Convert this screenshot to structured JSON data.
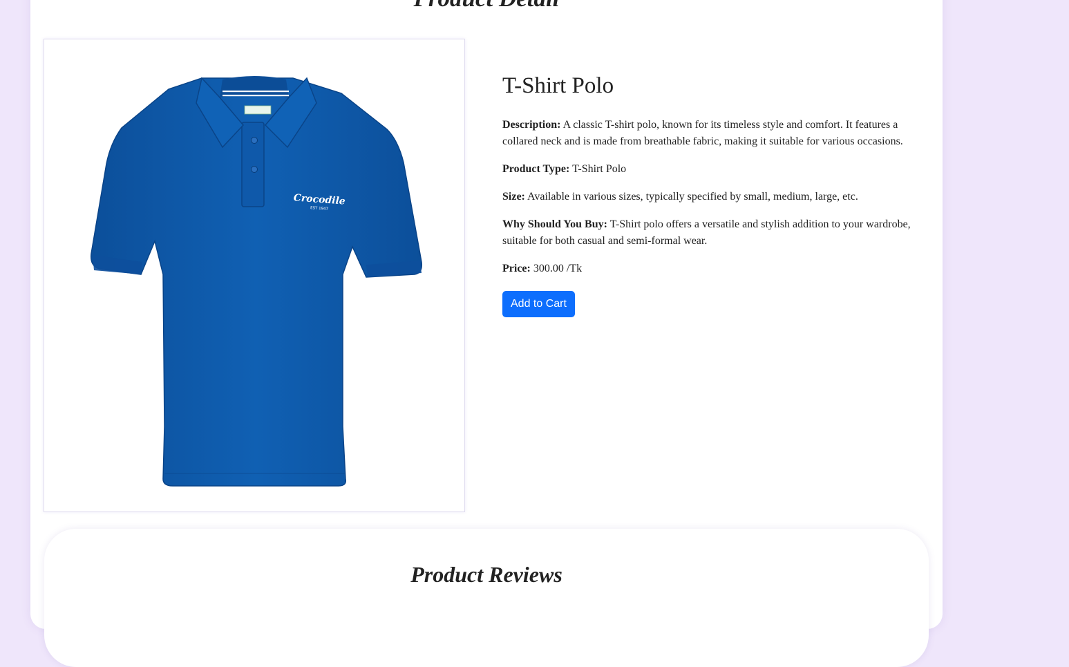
{
  "page": {
    "title": "Product Detail"
  },
  "product": {
    "name": "T-Shirt Polo",
    "image_alt": "Blue Crocodile polo t-shirt",
    "image_logo_text": "Crocodile",
    "image_logo_subtext": "EST 1947",
    "fields": [
      {
        "label": "Description:",
        "value": "A classic T-shirt polo, known for its timeless style and comfort. It features a collared neck and is made from breathable fabric, making it suitable for various occasions."
      },
      {
        "label": "Product Type:",
        "value": "T-Shirt Polo"
      },
      {
        "label": "Size:",
        "value": "Available in various sizes, typically specified by small, medium, large, etc."
      },
      {
        "label": "Why Should You Buy:",
        "value": "T-Shirt polo offers a versatile and stylish addition to your wardrobe, suitable for both casual and semi-formal wear."
      },
      {
        "label": "Price:",
        "value": "300.00 /Tk"
      }
    ],
    "add_to_cart_label": "Add to Cart"
  },
  "reviews": {
    "title": "Product Reviews"
  },
  "colors": {
    "background": "#efe6fb",
    "button": "#0d6efd",
    "shirt": "#0f57a8"
  }
}
